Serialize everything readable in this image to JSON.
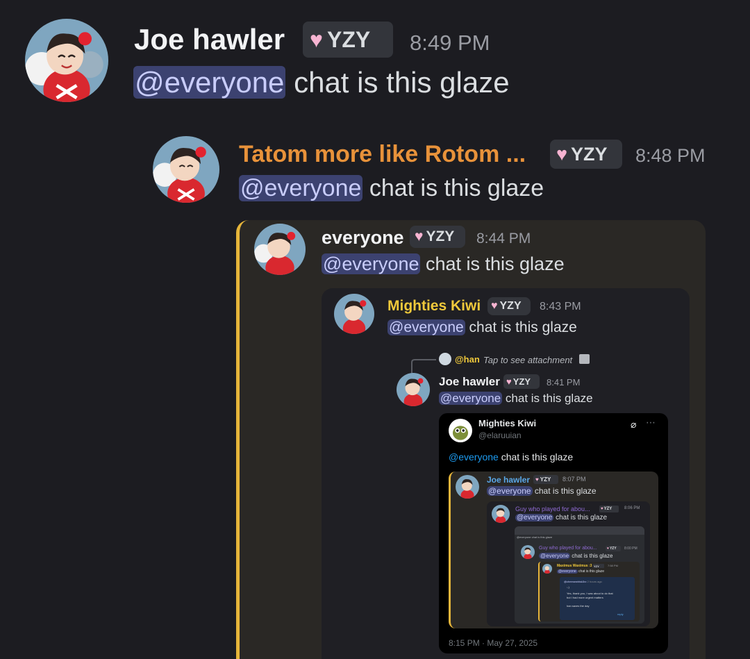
{
  "messages": [
    {
      "author": "Joe hawler",
      "tag": "YZY",
      "time": "8:49 PM",
      "mention": "@everyone",
      "text": " chat is this glaze"
    },
    {
      "author": "Tatom more like Rotom ...",
      "tag": "YZY",
      "time": "8:48 PM",
      "mention": "@everyone",
      "text": " chat is this glaze",
      "author_color": "#e8923a"
    },
    {
      "author": "everyone",
      "tag": "YZY",
      "time": "8:44 PM",
      "mention": "@everyone",
      "text": " chat is this glaze"
    },
    {
      "author": "Mighties Kiwi",
      "tag": "YZY",
      "time": "8:43 PM",
      "mention": "@everyone",
      "text": " chat is this glaze",
      "author_color": "#f0c93b"
    },
    {
      "reply_to": "@han",
      "reply_preview": "Tap to see attachment",
      "author": "Joe hawler",
      "tag": "YZY",
      "time": "8:41 PM",
      "mention": "@everyone",
      "text": " chat is this glaze"
    }
  ],
  "tweet": {
    "display_name": "Mighties Kiwi",
    "handle": "@elaruuian",
    "mention": "@everyone",
    "text": " chat is this glaze",
    "footer": "8:15 PM · May 27, 2025",
    "mention_color": "#1d9bf0"
  },
  "nested": [
    {
      "author": "Joe hawler",
      "tag": "YZY",
      "time": "8:07 PM",
      "mention": "@everyone",
      "text": " chat is this glaze",
      "author_color": "#5aa8e8"
    },
    {
      "author": "Guy who played for abou...",
      "tag": "YZY",
      "time": "8:06 PM",
      "mention": "@everyone",
      "text": " chat is this glaze",
      "author_color": "#8e6ad1"
    },
    {
      "author": "Guy who played for abou...",
      "tag": "YZY",
      "time": "8:00 PM",
      "mention": "@everyone",
      "text": " chat is this glaze",
      "author_color": "#8e6ad1"
    },
    {
      "author": "Maximus Waximus :3",
      "tag": "YZY",
      "time": "7:58 PM",
      "mention": "@everyone",
      "text": " chat is this glaze",
      "author_color": "#f0c93b"
    }
  ],
  "deep_embed": {
    "small_header": "@everyone chat is this glaze",
    "handle": "@cheesewhisk3rz",
    "age": "2 hours ago",
    "line1": ":-)",
    "line2": "Yes, thank you, I was about to do that",
    "line3": "but I had more urgent matters",
    "line4": "han saves the day",
    "reply": "reply"
  },
  "colors": {
    "background": "#1c1c21",
    "embed_accent": "#e6b53a",
    "mention_bg": "#3c4270",
    "mention_text": "#c9cdfb"
  },
  "icons": [
    "heart-icon",
    "image-icon",
    "grok-icon",
    "more-icon",
    "avatar"
  ]
}
